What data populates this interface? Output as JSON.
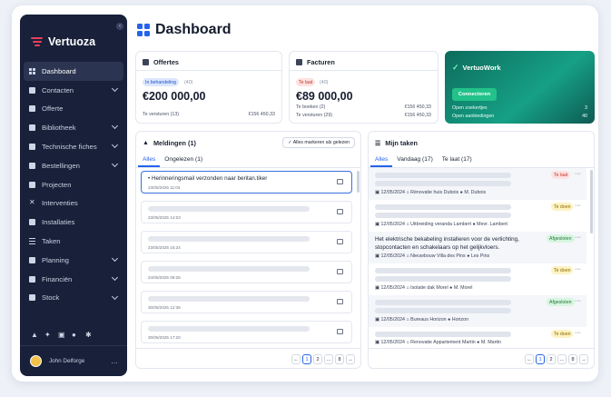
{
  "app": {
    "name": "Vertuoza"
  },
  "sidebar": {
    "items": [
      {
        "label": "Dashboard"
      },
      {
        "label": "Contacten"
      },
      {
        "label": "Offerte"
      },
      {
        "label": "Bibliotheek"
      },
      {
        "label": "Technische fiches"
      },
      {
        "label": "Bestellingen"
      },
      {
        "label": "Projecten"
      },
      {
        "label": "Interventies"
      },
      {
        "label": "Installaties"
      },
      {
        "label": "Taken"
      },
      {
        "label": "Planning"
      },
      {
        "label": "Financiën"
      },
      {
        "label": "Stock"
      }
    ],
    "user": {
      "name": "John Delforge"
    }
  },
  "page": {
    "title": "Dashboard"
  },
  "offertes": {
    "title": "Offertes",
    "badge": "In behandeling",
    "badge_count": "(40)",
    "amount": "€200 000,00",
    "row_label": "Te versturen (13)",
    "row_value": "€156 450,33"
  },
  "facturen": {
    "title": "Facturen",
    "badge": "Te laat",
    "badge_count": "(40)",
    "amount": "€89 000,00",
    "row1_label": "Te boeken (2)",
    "row1_value": "€156 450,33",
    "row2_label": "Te versturen (29)",
    "row2_value": "€156 450,33"
  },
  "vertuowork": {
    "name": "VertuoWork",
    "button": "Connecteren",
    "row1_label": "Open zoekertjes",
    "row1_value": "3",
    "row2_label": "Open aanbiedingen",
    "row2_value": "40"
  },
  "meldingen": {
    "title": "Meldingen (1)",
    "mark_all": "Alles markeren als gelezen",
    "tabs": [
      "Alles",
      "Ongelezen (1)"
    ],
    "items": [
      {
        "text": "Herinneringsmail verzonden naar beritan.tiker",
        "date": "23/05/2025 11:03"
      },
      {
        "date": "23/05/2025 14:03"
      },
      {
        "date": "23/05/2025 15:34"
      },
      {
        "date": "24/05/2025 08:25"
      },
      {
        "date": "30/05/2025 12:36"
      },
      {
        "date": "30/05/2025 17:20"
      }
    ],
    "pager": [
      "←",
      "1",
      "2",
      "...",
      "8",
      "→"
    ]
  },
  "taken": {
    "title": "Mijn taken",
    "tabs": [
      "Alles",
      "Vandaag (17)",
      "Te laat (17)"
    ],
    "items": [
      {
        "status": "Te laat",
        "date": "12/05/2024",
        "project": "Rénovatie huis Dubois",
        "person": "M. Dubois"
      },
      {
        "status": "Te doen",
        "date": "12/05/2024",
        "project": "Uitbreiding veranda Lambert",
        "person": "Mevr. Lambert"
      },
      {
        "status": "Afgesloten",
        "title": "Het elektrische bekabeling installeren voor de verlichting, stopcontacten en schakelaars op het gelijkvloers.",
        "date": "12/05/2024",
        "project": "Nieuwbouw Villa des Pins",
        "person": "Les Pins"
      },
      {
        "status": "Te doen",
        "date": "12/05/2024",
        "project": "Isolatie dak Morel",
        "person": "M. Morel"
      },
      {
        "status": "Afgesloten",
        "date": "12/05/2024",
        "project": "Bureaus Horizon",
        "person": "Horizon"
      },
      {
        "status": "Te doen",
        "date": "12/05/2024",
        "project": "Renovatie Appartement Martin",
        "person": "M. Martin"
      }
    ],
    "pager": [
      "←",
      "1",
      "2",
      "...",
      "8",
      "→"
    ]
  },
  "colors": {
    "sidebar": "#18203a",
    "accent": "#2563eb",
    "vertuowork": "#16a085"
  }
}
